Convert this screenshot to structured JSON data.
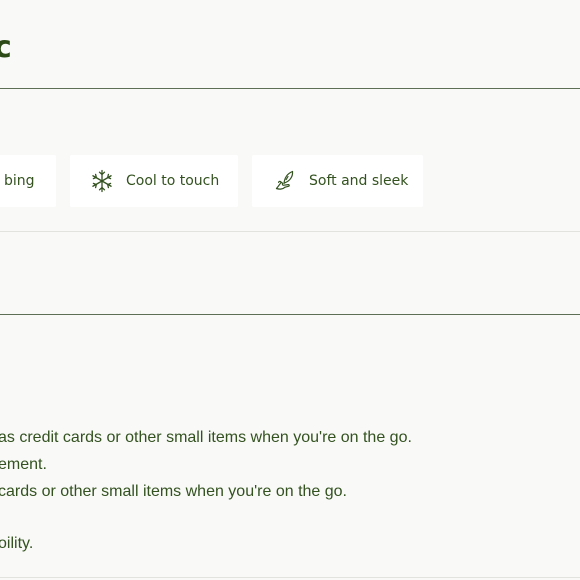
{
  "section_heading_fragment": "c",
  "features": [
    {
      "label": "bing",
      "icon": "partial-icon"
    },
    {
      "label": "Cool to touch",
      "icon": "snowflake-icon"
    },
    {
      "label": "Soft and sleek",
      "icon": "hand-feather-icon"
    }
  ],
  "description_lines": [
    "as credit cards or other small items when you're on the go.",
    "ement.",
    "cards or other small items when you're on the go.",
    "oility."
  ],
  "colors": {
    "text": "#33521f",
    "heading": "#2c4a16",
    "divider": "#5d6f55",
    "background": "#f9f9f8",
    "chip": "#ffffff"
  }
}
